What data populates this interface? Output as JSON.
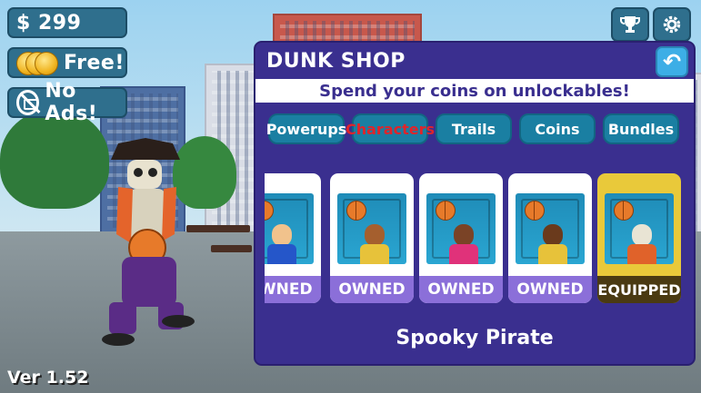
{
  "hud": {
    "coins_label": "$ 299",
    "free_label": "Free!",
    "noads_label": "No Ads!",
    "version": "Ver 1.52"
  },
  "shop": {
    "title": "DUNK SHOP",
    "subtitle": "Spend your coins on unlockables!",
    "tabs": [
      {
        "label": "Powerups",
        "active": false
      },
      {
        "label": "Characters",
        "active": true
      },
      {
        "label": "Trails",
        "active": false
      },
      {
        "label": "Coins",
        "active": false
      },
      {
        "label": "Bundles",
        "active": false
      }
    ],
    "cards": [
      {
        "status": "OWNED",
        "skin": "#f1c28c",
        "jersey": "#2556c9"
      },
      {
        "status": "OWNED",
        "skin": "#a55f2e",
        "jersey": "#e7c23a"
      },
      {
        "status": "OWNED",
        "skin": "#7a4326",
        "jersey": "#e0327a"
      },
      {
        "status": "OWNED",
        "skin": "#6a3a1c",
        "jersey": "#e7c23a"
      },
      {
        "status": "EQUIPPED",
        "skin": "#e9e4d4",
        "jersey": "#e0622a"
      }
    ],
    "selected_name": "Spooky Pirate"
  },
  "icons": {
    "trophy": "trophy-icon",
    "settings": "gear-icon",
    "back": "back-arrow-icon"
  },
  "colors": {
    "panel": "#3a2f8f",
    "tab": "#1a7fa2",
    "active_tab_text": "#e0242a",
    "owned_band": "#8b6fd9",
    "equipped_card": "#e9c93a"
  }
}
